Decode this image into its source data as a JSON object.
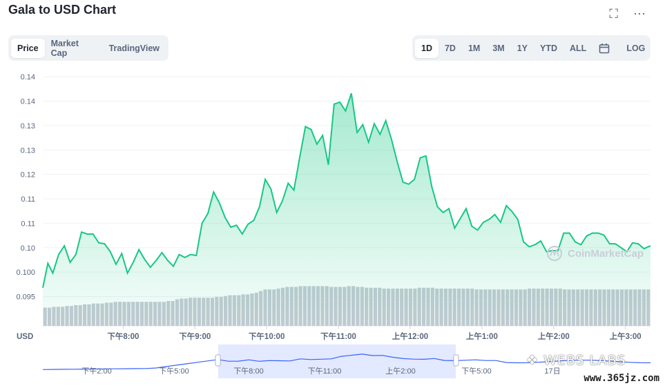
{
  "header": {
    "title": "Gala to USD Chart",
    "fullscreen_icon": "fullscreen-icon",
    "more_icon": "more-icon"
  },
  "tabs_left": [
    {
      "label": "Price",
      "active": true
    },
    {
      "label": "Market Cap",
      "active": false
    },
    {
      "label": "TradingView",
      "active": false
    }
  ],
  "tabs_right": [
    {
      "label": "1D",
      "active": true
    },
    {
      "label": "7D",
      "active": false
    },
    {
      "label": "1M",
      "active": false
    },
    {
      "label": "3M",
      "active": false
    },
    {
      "label": "1Y",
      "active": false
    },
    {
      "label": "YTD",
      "active": false
    },
    {
      "label": "ALL",
      "active": false
    }
  ],
  "calendar_icon": "calendar-icon",
  "log_label": "LOG",
  "currency_label": "USD",
  "watermark": "CoinMarketCap",
  "overlay_watermark": "WEBS LABS",
  "site_watermark": "www.365jz.com",
  "colors": {
    "line": "#16c784",
    "fill_top": "#16c784",
    "volume": "#c6cbd4",
    "navigator_line": "#3861fb",
    "navigator_selection": "#e3e9ff"
  },
  "chart_data": {
    "type": "line",
    "title": "Gala to USD Chart",
    "ylabel": "USD",
    "y_ticks": [
      "0.14",
      "0.14",
      "0.13",
      "0.13",
      "0.12",
      "0.11",
      "0.11",
      "0.10",
      "0.100",
      "0.095"
    ],
    "y_tick_values": [
      0.1435,
      0.141,
      0.1385,
      0.136,
      0.1335,
      0.131,
      0.1285,
      0.126,
      0.1235,
      0.121
    ],
    "ylim": [
      0.118,
      0.1445
    ],
    "x_ticks": [
      "下午8:00",
      "下午9:00",
      "下午10:00",
      "下午11:00",
      "上午12:00",
      "上午1:00",
      "上午2:00",
      "上午3:00"
    ],
    "x_tick_hours": [
      1,
      2,
      3,
      4,
      5,
      6,
      7,
      8
    ],
    "xlim": [
      -0.12,
      8.35
    ],
    "grid": true,
    "series": [
      {
        "x": [
          -0.12,
          -0.05,
          0.02,
          0.1,
          0.18,
          0.26,
          0.34,
          0.42,
          0.5,
          0.58,
          0.66,
          0.74,
          0.82,
          0.9,
          0.98,
          1.06,
          1.14,
          1.22,
          1.3,
          1.38,
          1.46,
          1.54,
          1.62,
          1.7,
          1.78,
          1.86,
          1.94,
          2.02,
          2.1,
          2.18,
          2.26,
          2.34,
          2.42,
          2.5,
          2.58,
          2.66,
          2.74,
          2.82,
          2.9,
          2.98,
          3.06,
          3.14,
          3.22,
          3.3,
          3.38,
          3.46,
          3.54,
          3.62,
          3.7,
          3.78,
          3.86,
          3.94,
          4.02,
          4.1,
          4.18,
          4.26,
          4.34,
          4.42,
          4.5,
          4.58,
          4.66,
          4.74,
          4.82,
          4.9,
          4.98,
          5.06,
          5.14,
          5.22,
          5.3,
          5.38,
          5.46,
          5.54,
          5.62,
          5.7,
          5.78,
          5.86,
          5.94,
          6.02,
          6.1,
          6.18,
          6.26,
          6.34,
          6.42,
          6.5,
          6.58,
          6.66,
          6.74,
          6.82,
          6.9,
          6.98,
          7.06,
          7.14,
          7.22,
          7.3,
          7.38,
          7.46,
          7.54,
          7.62,
          7.7,
          7.78,
          7.86,
          7.94,
          8.02,
          8.1,
          8.18,
          8.26,
          8.35
        ],
        "values": [
          0.1219,
          0.1244,
          0.1234,
          0.1253,
          0.1262,
          0.1245,
          0.1253,
          0.1276,
          0.1274,
          0.1274,
          0.1265,
          0.1264,
          0.1256,
          0.1243,
          0.1254,
          0.1234,
          0.1245,
          0.1258,
          0.1248,
          0.124,
          0.1247,
          0.1255,
          0.1247,
          0.1241,
          0.1253,
          0.125,
          0.1253,
          0.1252,
          0.1285,
          0.1295,
          0.1317,
          0.1306,
          0.1291,
          0.1281,
          0.1283,
          0.1274,
          0.1284,
          0.1288,
          0.1302,
          0.133,
          0.132,
          0.1296,
          0.1308,
          0.1326,
          0.1319,
          0.1352,
          0.1384,
          0.1381,
          0.1366,
          0.1375,
          0.1345,
          0.1407,
          0.1409,
          0.14,
          0.1418,
          0.1378,
          0.1386,
          0.1368,
          0.1387,
          0.1376,
          0.139,
          0.1371,
          0.1348,
          0.1327,
          0.1325,
          0.133,
          0.1352,
          0.1354,
          0.1323,
          0.1302,
          0.1296,
          0.13,
          0.128,
          0.129,
          0.13,
          0.1282,
          0.1278,
          0.1286,
          0.1289,
          0.1294,
          0.1286,
          0.1303,
          0.1297,
          0.1289,
          0.1266,
          0.1261,
          0.1263,
          0.1267,
          0.1256,
          0.1257,
          0.1257,
          0.1275,
          0.1275,
          0.1266,
          0.1263,
          0.1272,
          0.1275,
          0.1275,
          0.1273,
          0.1264,
          0.1264,
          0.126,
          0.1256,
          0.1265,
          0.1264,
          0.1259,
          0.1262
        ]
      }
    ],
    "volume": {
      "values": [
        22,
        22,
        23,
        23,
        23,
        24,
        24,
        25,
        25,
        26,
        26,
        27,
        27,
        27,
        28,
        28,
        29,
        29,
        29,
        29,
        29,
        29,
        29,
        29,
        29,
        29,
        29,
        29,
        30,
        30,
        32,
        33,
        33,
        34,
        34,
        34,
        34,
        34,
        34,
        35,
        35,
        36,
        37,
        37,
        37,
        38,
        38,
        39,
        40,
        42,
        44,
        44,
        44,
        45,
        46,
        47,
        47,
        47,
        48,
        48,
        48,
        48,
        48,
        48,
        48,
        47,
        47,
        47,
        47,
        48,
        48,
        47,
        47,
        46,
        46,
        46,
        46,
        45,
        45,
        45,
        45,
        45,
        45,
        45,
        45,
        46,
        46,
        46,
        46,
        45,
        45,
        45,
        45,
        45,
        45,
        45,
        45,
        45,
        44,
        44,
        44,
        44,
        44,
        44,
        44,
        44,
        44,
        44,
        44,
        44,
        45,
        45,
        45,
        45,
        45,
        45,
        45,
        45,
        44,
        44,
        44,
        44,
        44,
        44,
        44,
        44,
        44,
        44,
        44,
        44,
        44,
        44,
        44,
        44,
        44,
        44,
        44,
        44
      ]
    },
    "navigator": {
      "x_ticks": [
        "下午2:00",
        "下午5:00",
        "下午8:00",
        "下午11:00",
        "上午2:00",
        "下午5:00",
        "17日"
      ]
    }
  }
}
